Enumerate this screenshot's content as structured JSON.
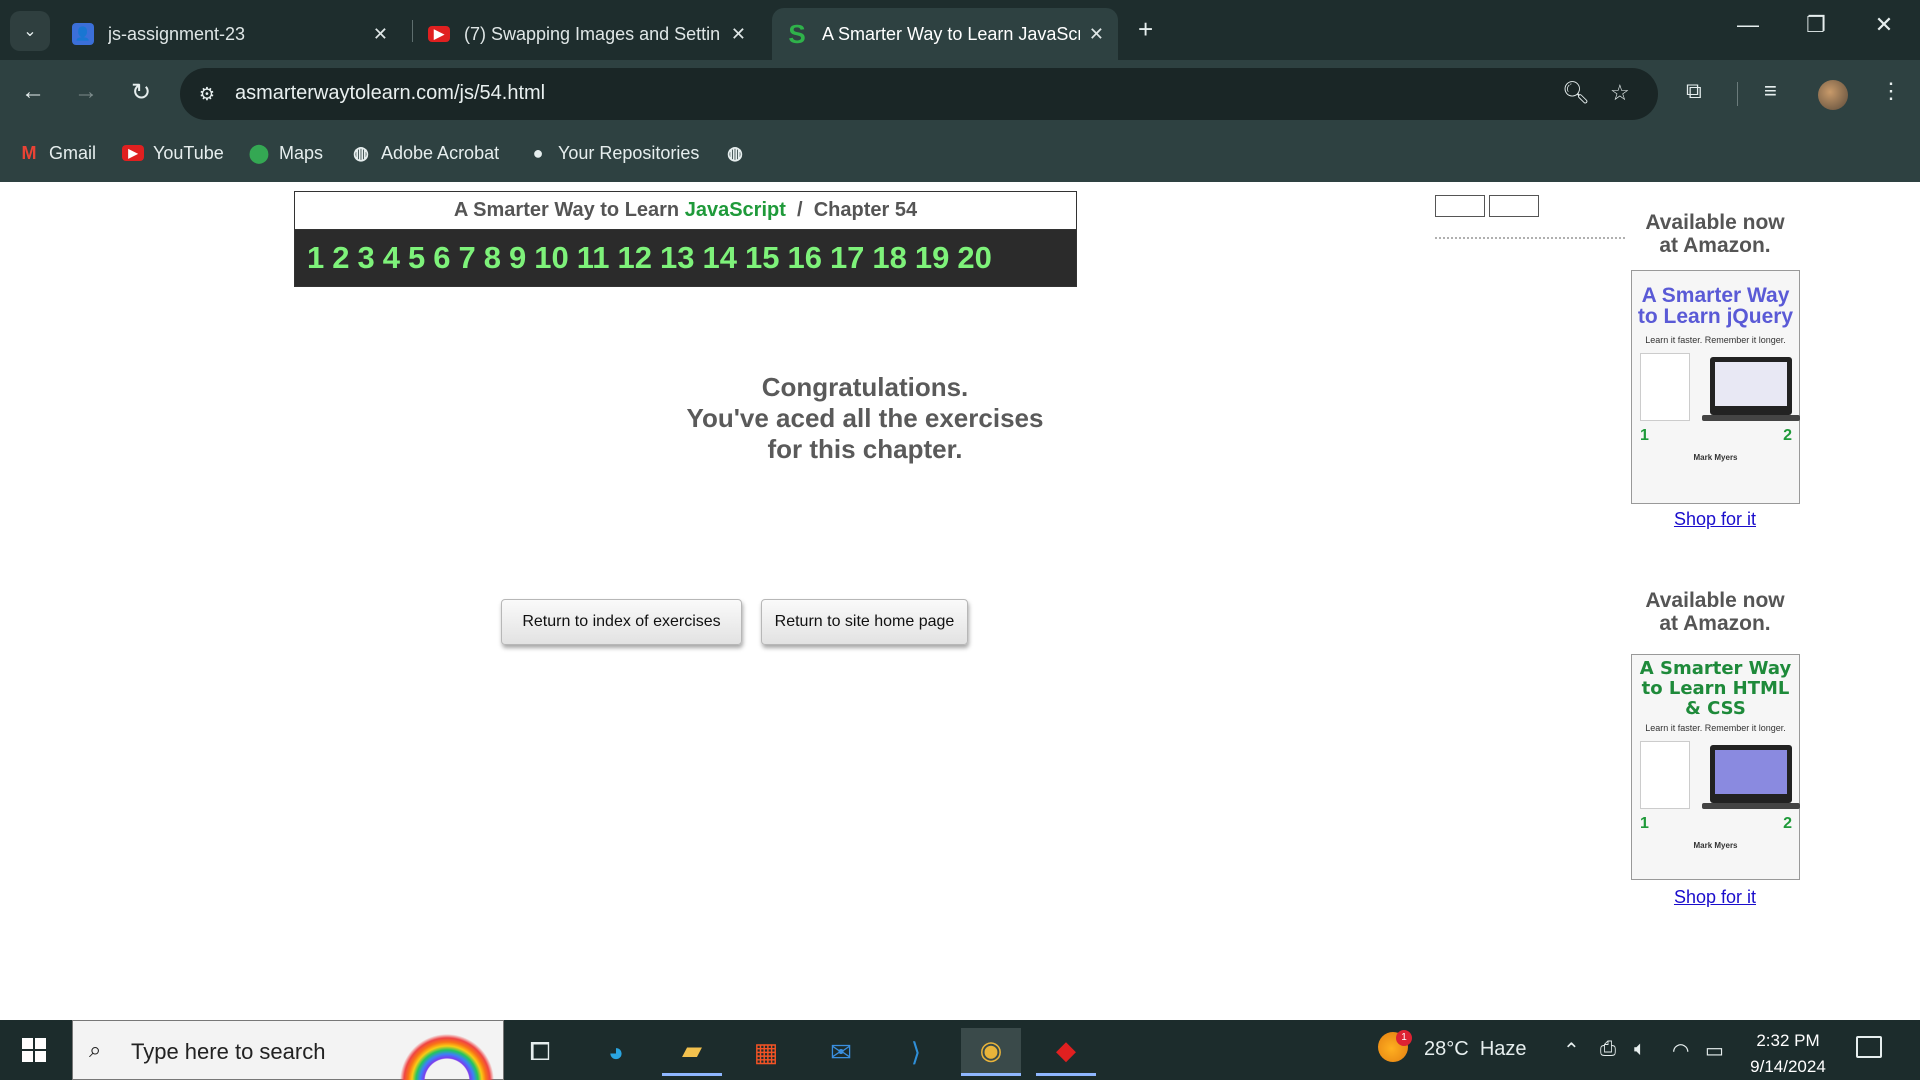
{
  "browser": {
    "tabs": [
      {
        "title": "js-assignment-23",
        "favicon": "classroom-icon",
        "active": false
      },
      {
        "title": "(7) Swapping Images and Settin",
        "favicon": "youtube-icon",
        "active": false
      },
      {
        "title": "A Smarter Way to Learn JavaScr",
        "favicon": "s-logo-icon",
        "active": true
      }
    ],
    "url": "asmarterwaytolearn.com/js/54.html",
    "bookmarks": [
      {
        "label": "Gmail",
        "icon": "gmail-icon"
      },
      {
        "label": "YouTube",
        "icon": "youtube-icon"
      },
      {
        "label": "Maps",
        "icon": "maps-icon"
      },
      {
        "label": "Adobe Acrobat",
        "icon": "globe-icon"
      },
      {
        "label": "Your Repositories",
        "icon": "github-icon"
      }
    ]
  },
  "page": {
    "header": {
      "prefix": "A Smarter Way to Learn",
      "brand": "JavaScript",
      "separator": "/",
      "chapter": "Chapter 54"
    },
    "exercise_numbers": [
      "1",
      "2",
      "3",
      "4",
      "5",
      "6",
      "7",
      "8",
      "9",
      "10",
      "11",
      "12",
      "13",
      "14",
      "15",
      "16",
      "17",
      "18",
      "19",
      "20"
    ],
    "congrats": {
      "line1": "Congratulations.",
      "line2": "You've aced all the exercises",
      "line3": "for this chapter."
    },
    "buttons": {
      "index": "Return to index of exercises",
      "home": "Return to site home page"
    },
    "sidebar": {
      "promos": [
        {
          "available_line1": "Available now",
          "available_line2": "at Amazon.",
          "book_title": "A Smarter Way to Learn jQuery",
          "book_tagline": "Learn it faster. Remember it longer.",
          "author": "Mark Myers",
          "shop": "Shop for it"
        },
        {
          "available_line1": "Available now",
          "available_line2": "at Amazon.",
          "book_title": "A Smarter Way to Learn HTML & CSS",
          "book_tagline": "Learn it faster. Remember it longer.",
          "author": "Mark Myers",
          "shop": "Shop for it"
        }
      ]
    },
    "colors": {
      "brand_green": "#1f9a3a",
      "number_green": "#7ef27a",
      "link_blue": "#1a0dcc"
    }
  },
  "taskbar": {
    "search_placeholder": "Type here to search",
    "weather_temp": "28°C",
    "weather_desc": "Haze",
    "weather_badge": "1",
    "time": "2:32 PM",
    "date": "9/14/2024",
    "apps": [
      "task-view-icon",
      "edge-icon",
      "file-explorer-icon",
      "store-icon",
      "mail-icon",
      "vscode-icon",
      "chrome-icon",
      "acrobat-icon"
    ]
  }
}
